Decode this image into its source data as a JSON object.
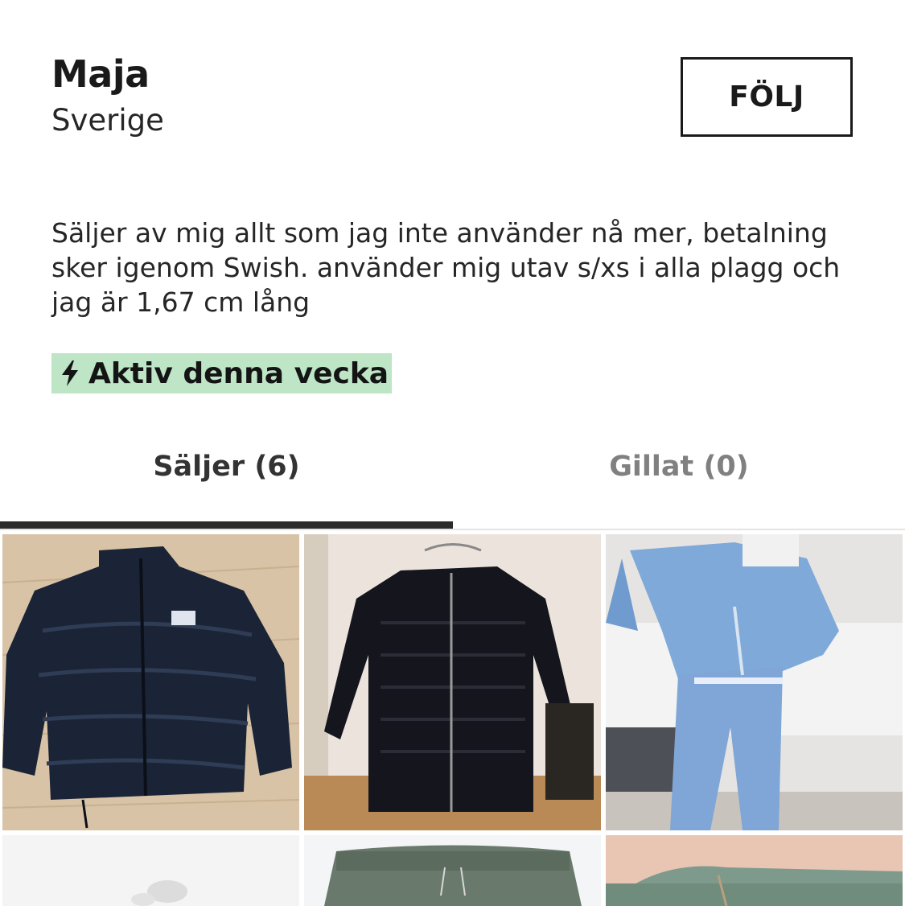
{
  "profile": {
    "name": "Maja",
    "location": "Sverige",
    "follow_label": "FÖLJ",
    "bio": "Säljer av mig allt som jag inte använder nå mer, betalning sker igenom Swish. använder mig utav s/xs i alla plagg och jag är 1,67 cm lång",
    "activity_badge": "Aktiv denna vecka",
    "activity_icon": "lightning-bolt-icon"
  },
  "tabs": [
    {
      "label": "Säljer (6)",
      "selected": true
    },
    {
      "label": "Gillat (0)",
      "selected": false
    }
  ],
  "colors": {
    "activity_badge_bg": "#bde5c6",
    "tab_selected_text": "#333333",
    "tab_unselected_text": "#808080",
    "tab_indicator": "#2b2b2b"
  },
  "listings": [
    {
      "name": "listing-navy-puffer-jacket"
    },
    {
      "name": "listing-black-quilted-cardigan"
    },
    {
      "name": "listing-light-blue-tracksuit"
    },
    {
      "name": "listing-white-item"
    },
    {
      "name": "listing-green-sweatpants"
    },
    {
      "name": "listing-green-velour-top"
    }
  ]
}
